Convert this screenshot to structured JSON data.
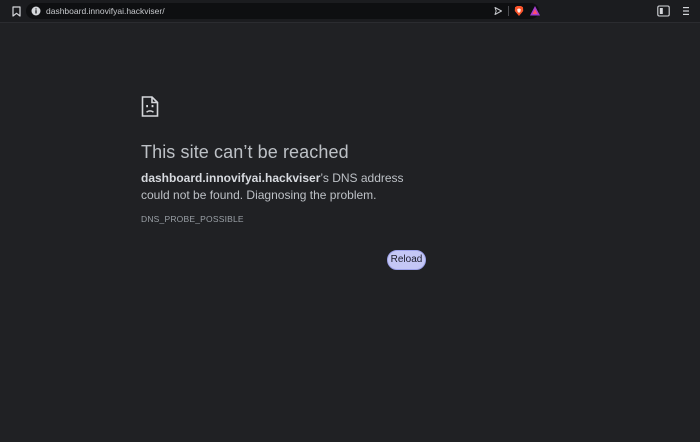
{
  "browser": {
    "url": "dashboard.innovifyai.hackviser/"
  },
  "error_page": {
    "title": "This site can’t be reached",
    "host": "dashboard.innovifyai.hackviser",
    "description_suffix": "’s DNS address could not be found. Diagnosing the problem.",
    "error_code": "DNS_PROBE_POSSIBLE",
    "reload_label": "Reload"
  },
  "icons": {
    "bookmark": "bookmark-icon",
    "info": "info-icon",
    "send": "send-icon",
    "shields": "brave-shields-icon",
    "rewards": "brave-rewards-icon",
    "sidebar": "sidebar-toggle-icon",
    "menu": "menu-icon",
    "sad_page": "sad-page-icon"
  },
  "colors": {
    "background": "#202124",
    "text": "#bdc1c6",
    "button": "#c4c7f5",
    "shields": "#fb542b"
  }
}
